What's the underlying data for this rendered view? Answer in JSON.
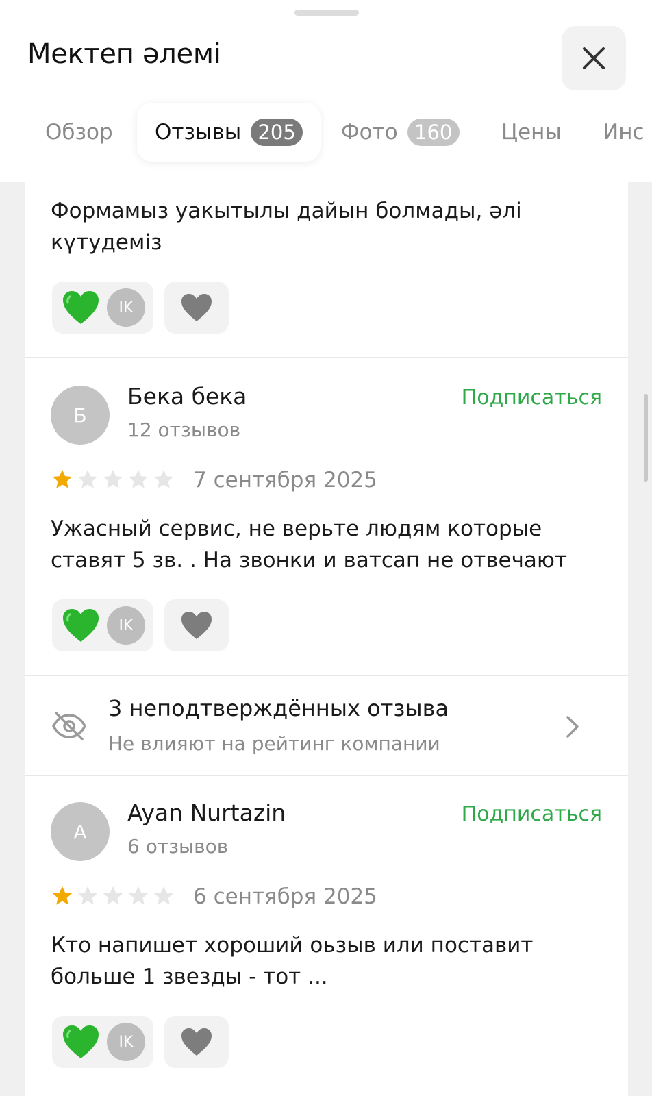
{
  "header": {
    "title": "Мектеп әлемі",
    "close_icon": "close-icon"
  },
  "tabs": [
    {
      "label": "Обзор",
      "badge": null,
      "active": false
    },
    {
      "label": "Отзывы",
      "badge": "205",
      "active": true
    },
    {
      "label": "Фото",
      "badge": "160",
      "active": false
    },
    {
      "label": "Цены",
      "badge": null,
      "active": false
    },
    {
      "label": "Инс",
      "badge": null,
      "active": false
    }
  ],
  "reviews": [
    {
      "text": "Формамыз уакытылы дайын болмады, әлі күтудеміз",
      "reaction_avatar": "IK"
    },
    {
      "author_initial": "Б",
      "author_name": "Бека бека",
      "author_reviews": "12 отзывов",
      "subscribe_label": "Подписаться",
      "rating": 1,
      "max_rating": 5,
      "date": "7 сентября 2025",
      "text": "Ужасный сервис, не верьте людям которые ставят 5 зв. . На звонки и ватсап не отвечают",
      "reaction_avatar": "IK"
    },
    {
      "author_initial": "A",
      "author_name": "Ayan Nurtazin",
      "author_reviews": "6 отзывов",
      "subscribe_label": "Подписаться",
      "rating": 1,
      "max_rating": 5,
      "date": "6 сентября 2025",
      "text": "Кто напишет хороший оьзыв или поставит больше 1 звезды - тот ...",
      "reaction_avatar": "IK"
    }
  ],
  "unconfirmed": {
    "title": "3 неподтверждённых отзыва",
    "subtitle": "Не влияют на рейтинг компании"
  },
  "colors": {
    "accent_green": "#2fa84a",
    "star_filled": "#f2a900",
    "star_empty": "#e6e6e6",
    "reaction_heart": "#2bb52f"
  }
}
